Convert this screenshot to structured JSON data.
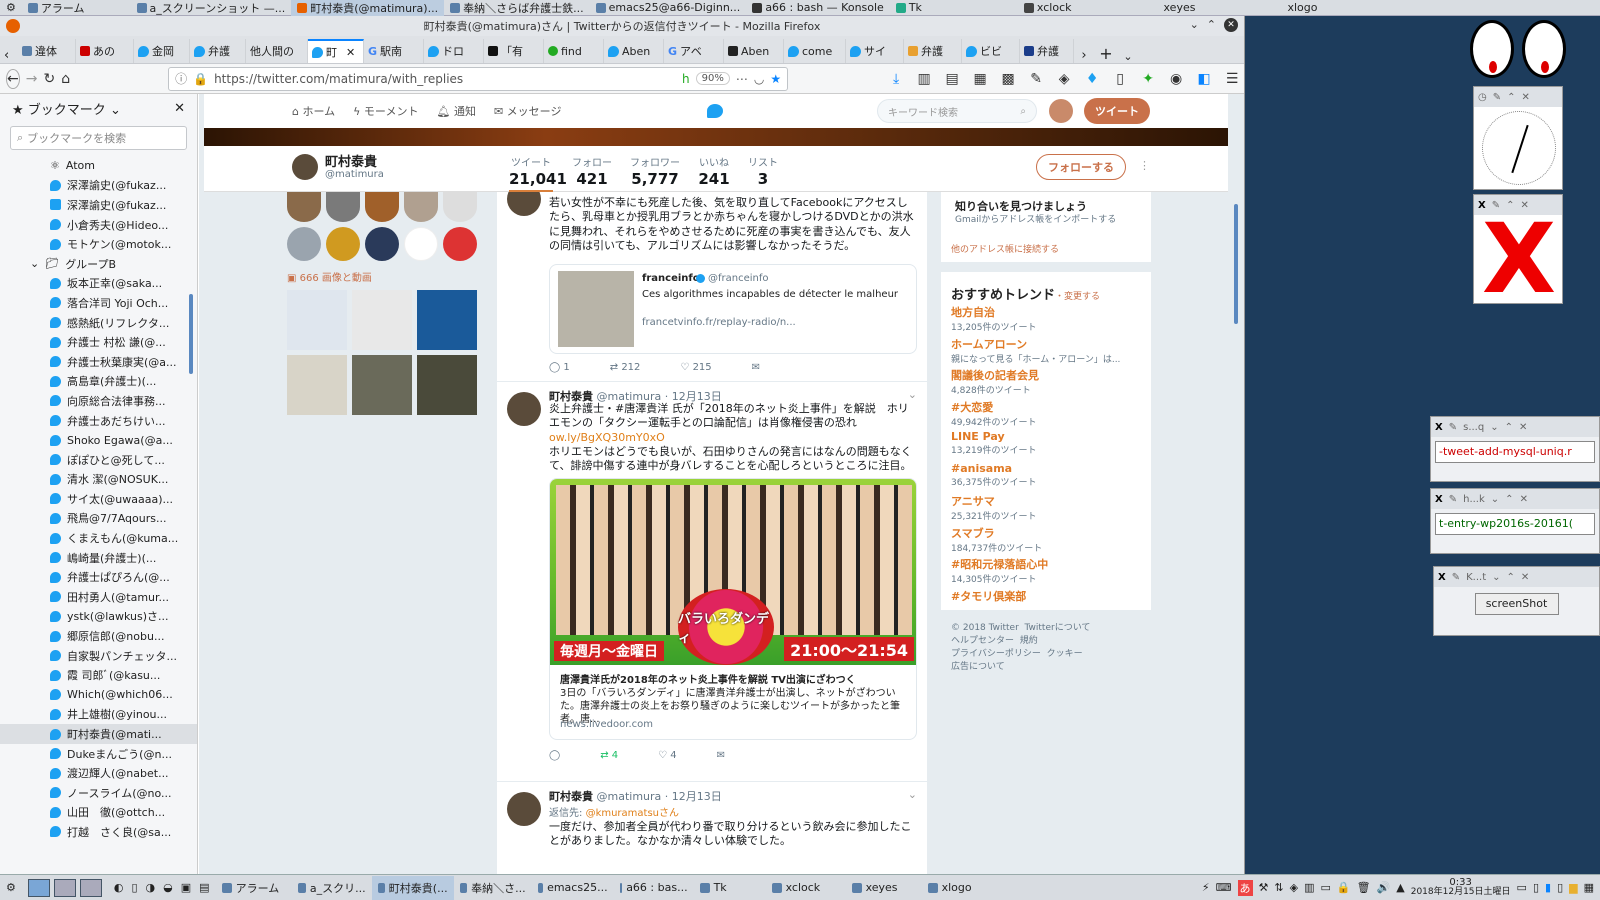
{
  "desktop_top": {
    "items": [
      {
        "label": "アラーム"
      },
      {
        "label": "a_スクリーンショット —..."
      },
      {
        "label": "町村泰貴(@matimura)..."
      },
      {
        "label": "奉納＼さらば弁護士鉄..."
      },
      {
        "label": "emacs25@a66-Diginn..."
      },
      {
        "label": "a66 : bash — Konsole"
      },
      {
        "label": "Tk"
      },
      {
        "label": "xclock"
      },
      {
        "label": "xeyes"
      },
      {
        "label": "xlogo"
      }
    ]
  },
  "window": {
    "title": "町村泰貴(@matimura)さん | Twitterからの返信付きツイート - Mozilla Firefox"
  },
  "tabs": [
    {
      "label": "違体"
    },
    {
      "label": "あの"
    },
    {
      "label": "金岡"
    },
    {
      "label": "弁護"
    },
    {
      "label": "他人間の"
    },
    {
      "label": "町"
    },
    {
      "label": "駅南"
    },
    {
      "label": "ドロ"
    },
    {
      "label": "「有"
    },
    {
      "label": "find"
    },
    {
      "label": "Aben"
    },
    {
      "label": "アベ"
    },
    {
      "label": "Aben"
    },
    {
      "label": "come"
    },
    {
      "label": "サイ"
    },
    {
      "label": "弁護"
    },
    {
      "label": "ビビ"
    },
    {
      "label": "弁護"
    }
  ],
  "navbar": {
    "url": "https://twitter.com/matimura/with_replies",
    "zoom": "90%"
  },
  "sidebar": {
    "title": "ブックマーク",
    "search_placeholder": "ブックマークを検索",
    "items": [
      {
        "label": "Atom",
        "indent": 0
      },
      {
        "label": "深澤諭史(@fukaz...",
        "indent": 0
      },
      {
        "label": "深澤諭史(@fukaz...",
        "indent": 0
      },
      {
        "label": "小倉秀夫(@Hideo...",
        "indent": 0
      },
      {
        "label": "モトケン(@motok...",
        "indent": 0
      },
      {
        "label": "グループB",
        "indent": -1
      },
      {
        "label": "坂本正幸(@saka...",
        "indent": 0
      },
      {
        "label": "落合洋司 Yoji Och...",
        "indent": 0
      },
      {
        "label": "感熱紙(リフレクタ...",
        "indent": 0
      },
      {
        "label": "弁護士 村松 謙(@...",
        "indent": 0
      },
      {
        "label": "弁護士秋葉康実(@a...",
        "indent": 0
      },
      {
        "label": "高島章(弁護士)(...",
        "indent": 0
      },
      {
        "label": "向原総合法律事務...",
        "indent": 0
      },
      {
        "label": "弁護士あだちけい...",
        "indent": 0
      },
      {
        "label": "Shoko Egawa(@a...",
        "indent": 0
      },
      {
        "label": "ぽぽひと@死して...",
        "indent": 0
      },
      {
        "label": "清水 潔(@NOSUK...",
        "indent": 0
      },
      {
        "label": "サイ太(@uwaaaa)...",
        "indent": 0
      },
      {
        "label": "飛鳥@7/7Aqours...",
        "indent": 0
      },
      {
        "label": "くまえもん(@kuma...",
        "indent": 0
      },
      {
        "label": "嶋崎量(弁護士)(...",
        "indent": 0
      },
      {
        "label": "弁護士ぱぴろん(@...",
        "indent": 0
      },
      {
        "label": "田村勇人(@tamur...",
        "indent": 0
      },
      {
        "label": "ystk(@lawkus)さ...",
        "indent": 0
      },
      {
        "label": "郷原信郎(@nobu...",
        "indent": 0
      },
      {
        "label": "自家製パンチェッタ...",
        "indent": 0
      },
      {
        "label": "霞 司郎ﾞ(@kasu...",
        "indent": 0
      },
      {
        "label": "Which(@which06...",
        "indent": 0
      },
      {
        "label": "井上雄樹(@yinou...",
        "indent": 0
      },
      {
        "label": "町村泰貴(@mati...",
        "indent": 0,
        "selected": true
      },
      {
        "label": "Dukeまんごう(@n...",
        "indent": 0
      },
      {
        "label": "渡辺輝人(@nabet...",
        "indent": 0
      },
      {
        "label": "ノースライム(@no...",
        "indent": 0
      },
      {
        "label": "山田　徹(@ottch...",
        "indent": 0
      },
      {
        "label": "打越　さく良(@sa...",
        "indent": 0
      }
    ]
  },
  "twitter_nav": {
    "home": "ホーム",
    "moments": "モーメント",
    "notifications": "通知",
    "messages": "メッセージ",
    "search_placeholder": "キーワード検索",
    "tweet_button": "ツイート"
  },
  "profile": {
    "name": "町村泰貴",
    "handle": "@matimura",
    "stats": [
      {
        "label": "ツイート",
        "value": "21,041"
      },
      {
        "label": "フォロー",
        "value": "421"
      },
      {
        "label": "フォロワー",
        "value": "5,777"
      },
      {
        "label": "いいね",
        "value": "241"
      },
      {
        "label": "リスト",
        "value": "3"
      }
    ],
    "follow_button": "フォローする",
    "media_label": "666 画像と動画"
  },
  "tweets": [
    {
      "text": "若い女性が不幸にも死産した後、気を取り直してFacebookにアクセスしたら、乳母車とか授乳用ブラとか赤ちゃんを寝かしつけるDVDとかの洪水に見舞われ、それらをやめさせるために死産の事実を書き込んでも、友人の同情は引いても、アルゴリズムには影響しなかったそうだ。",
      "card_source": "franceinfo",
      "card_handle": "@franceinfo",
      "card_title": "Ces algorithmes incapables de détecter le malheur",
      "card_url": "francetvinfo.fr/replay-radio/n...",
      "replies": "1",
      "retweets": "212",
      "likes": "215"
    },
    {
      "name": "町村泰貴",
      "handle": "@matimura",
      "date": "12月13日",
      "text1": "炎上弁護士・#唐澤貴洋 氏が「2018年のネット炎上事件」を解説　ホリエモンの「タクシー運転手との口論配信」は肖像権侵害の恐れ",
      "link": "ow.ly/BgXQ30mY0xO",
      "text2": "ホリエモンはどうでも良いが、石田ゆりさんの発言にはなんの問題もなくて、誹謗中傷する連中が身バレすることを心配しろというところに注目。",
      "banner_time": "21:00～21:54",
      "banner_days": "毎週月～金曜日",
      "banner_title": "バラいろダンディ",
      "card_title": "唐澤貴洋氏が2018年のネット炎上事件を解説 TV出演にざわつく",
      "card_desc": "3日の「バラいろダンディ」に唐澤貴洋弁護士が出演し、ネットがざわついた。唐澤弁護士の炎上をお祭り騒ぎのように楽しむツイートが多かったと筆者。唐...",
      "card_domain": "news.livedoor.com",
      "replies": "",
      "retweets": "4",
      "likes": "4"
    },
    {
      "name": "町村泰貴",
      "handle": "@matimura",
      "date": "12月13日",
      "reply_to_label": "返信先:",
      "reply_to": "@kmuramatsuさん",
      "text": "一度だけ、参加者全員が代わり番で取り分けるという飲み会に参加したことがありました。なかなか清々しい体験でした。"
    }
  ],
  "right_column": {
    "find_title": "知り合いを見つけましょう",
    "find_sub": "Gmailからアドレス帳をインポートする",
    "find_link": "他のアドレス帳に接続する",
    "trends_title": "おすすめトレンド",
    "trends_change": "・変更する",
    "trends": [
      {
        "name": "地方自治",
        "count": "13,205件のツイート"
      },
      {
        "name": "ホームアローン",
        "count": "親になって見る「ホーム・アローン」は..."
      },
      {
        "name": "閣議後の記者会見",
        "count": "4,828件のツイート"
      },
      {
        "name": "#大恋愛",
        "count": "49,942件のツイート"
      },
      {
        "name": "LINE Pay",
        "count": "13,219件のツイート"
      },
      {
        "name": "#anisama",
        "count": "36,375件のツイート"
      },
      {
        "name": "アニサマ",
        "count": "25,321件のツイート"
      },
      {
        "name": "スマブラ",
        "count": "184,737件のツイート"
      },
      {
        "name": "#昭和元禄落語心中",
        "count": "14,305件のツイート"
      },
      {
        "name": "#タモリ倶楽部",
        "count": ""
      }
    ],
    "footer": [
      "© 2018 Twitter",
      "Twitterについて",
      "ヘルプセンター",
      "規約",
      "プライバシーポリシー",
      "クッキー",
      "広告について"
    ]
  },
  "desktop_right": {
    "win1_text": "-tweet-add-mysql-uniq.r",
    "win2_text": "t-entry-wp2016s-20161(",
    "win3_button": "screenShot",
    "win1_title": "s...q",
    "win2_title": "h...k",
    "win3_title": "K...t"
  },
  "taskbar": {
    "items": [
      {
        "label": "アラーム"
      },
      {
        "label": "a_スクリ..."
      },
      {
        "label": "町村泰貴(..."
      },
      {
        "label": "奉納＼さ..."
      },
      {
        "label": "emacs25..."
      },
      {
        "label": "a66 : bas..."
      },
      {
        "label": "Tk"
      },
      {
        "label": "xclock"
      },
      {
        "label": "xeyes"
      },
      {
        "label": "xlogo"
      }
    ],
    "time": "0:33",
    "date": "2018年12月15日土曜日"
  },
  "colors": {
    "twitter_blue": "#1da1f2",
    "twitter_orange": "#e07a25",
    "tweet_button": "#c9714a"
  }
}
